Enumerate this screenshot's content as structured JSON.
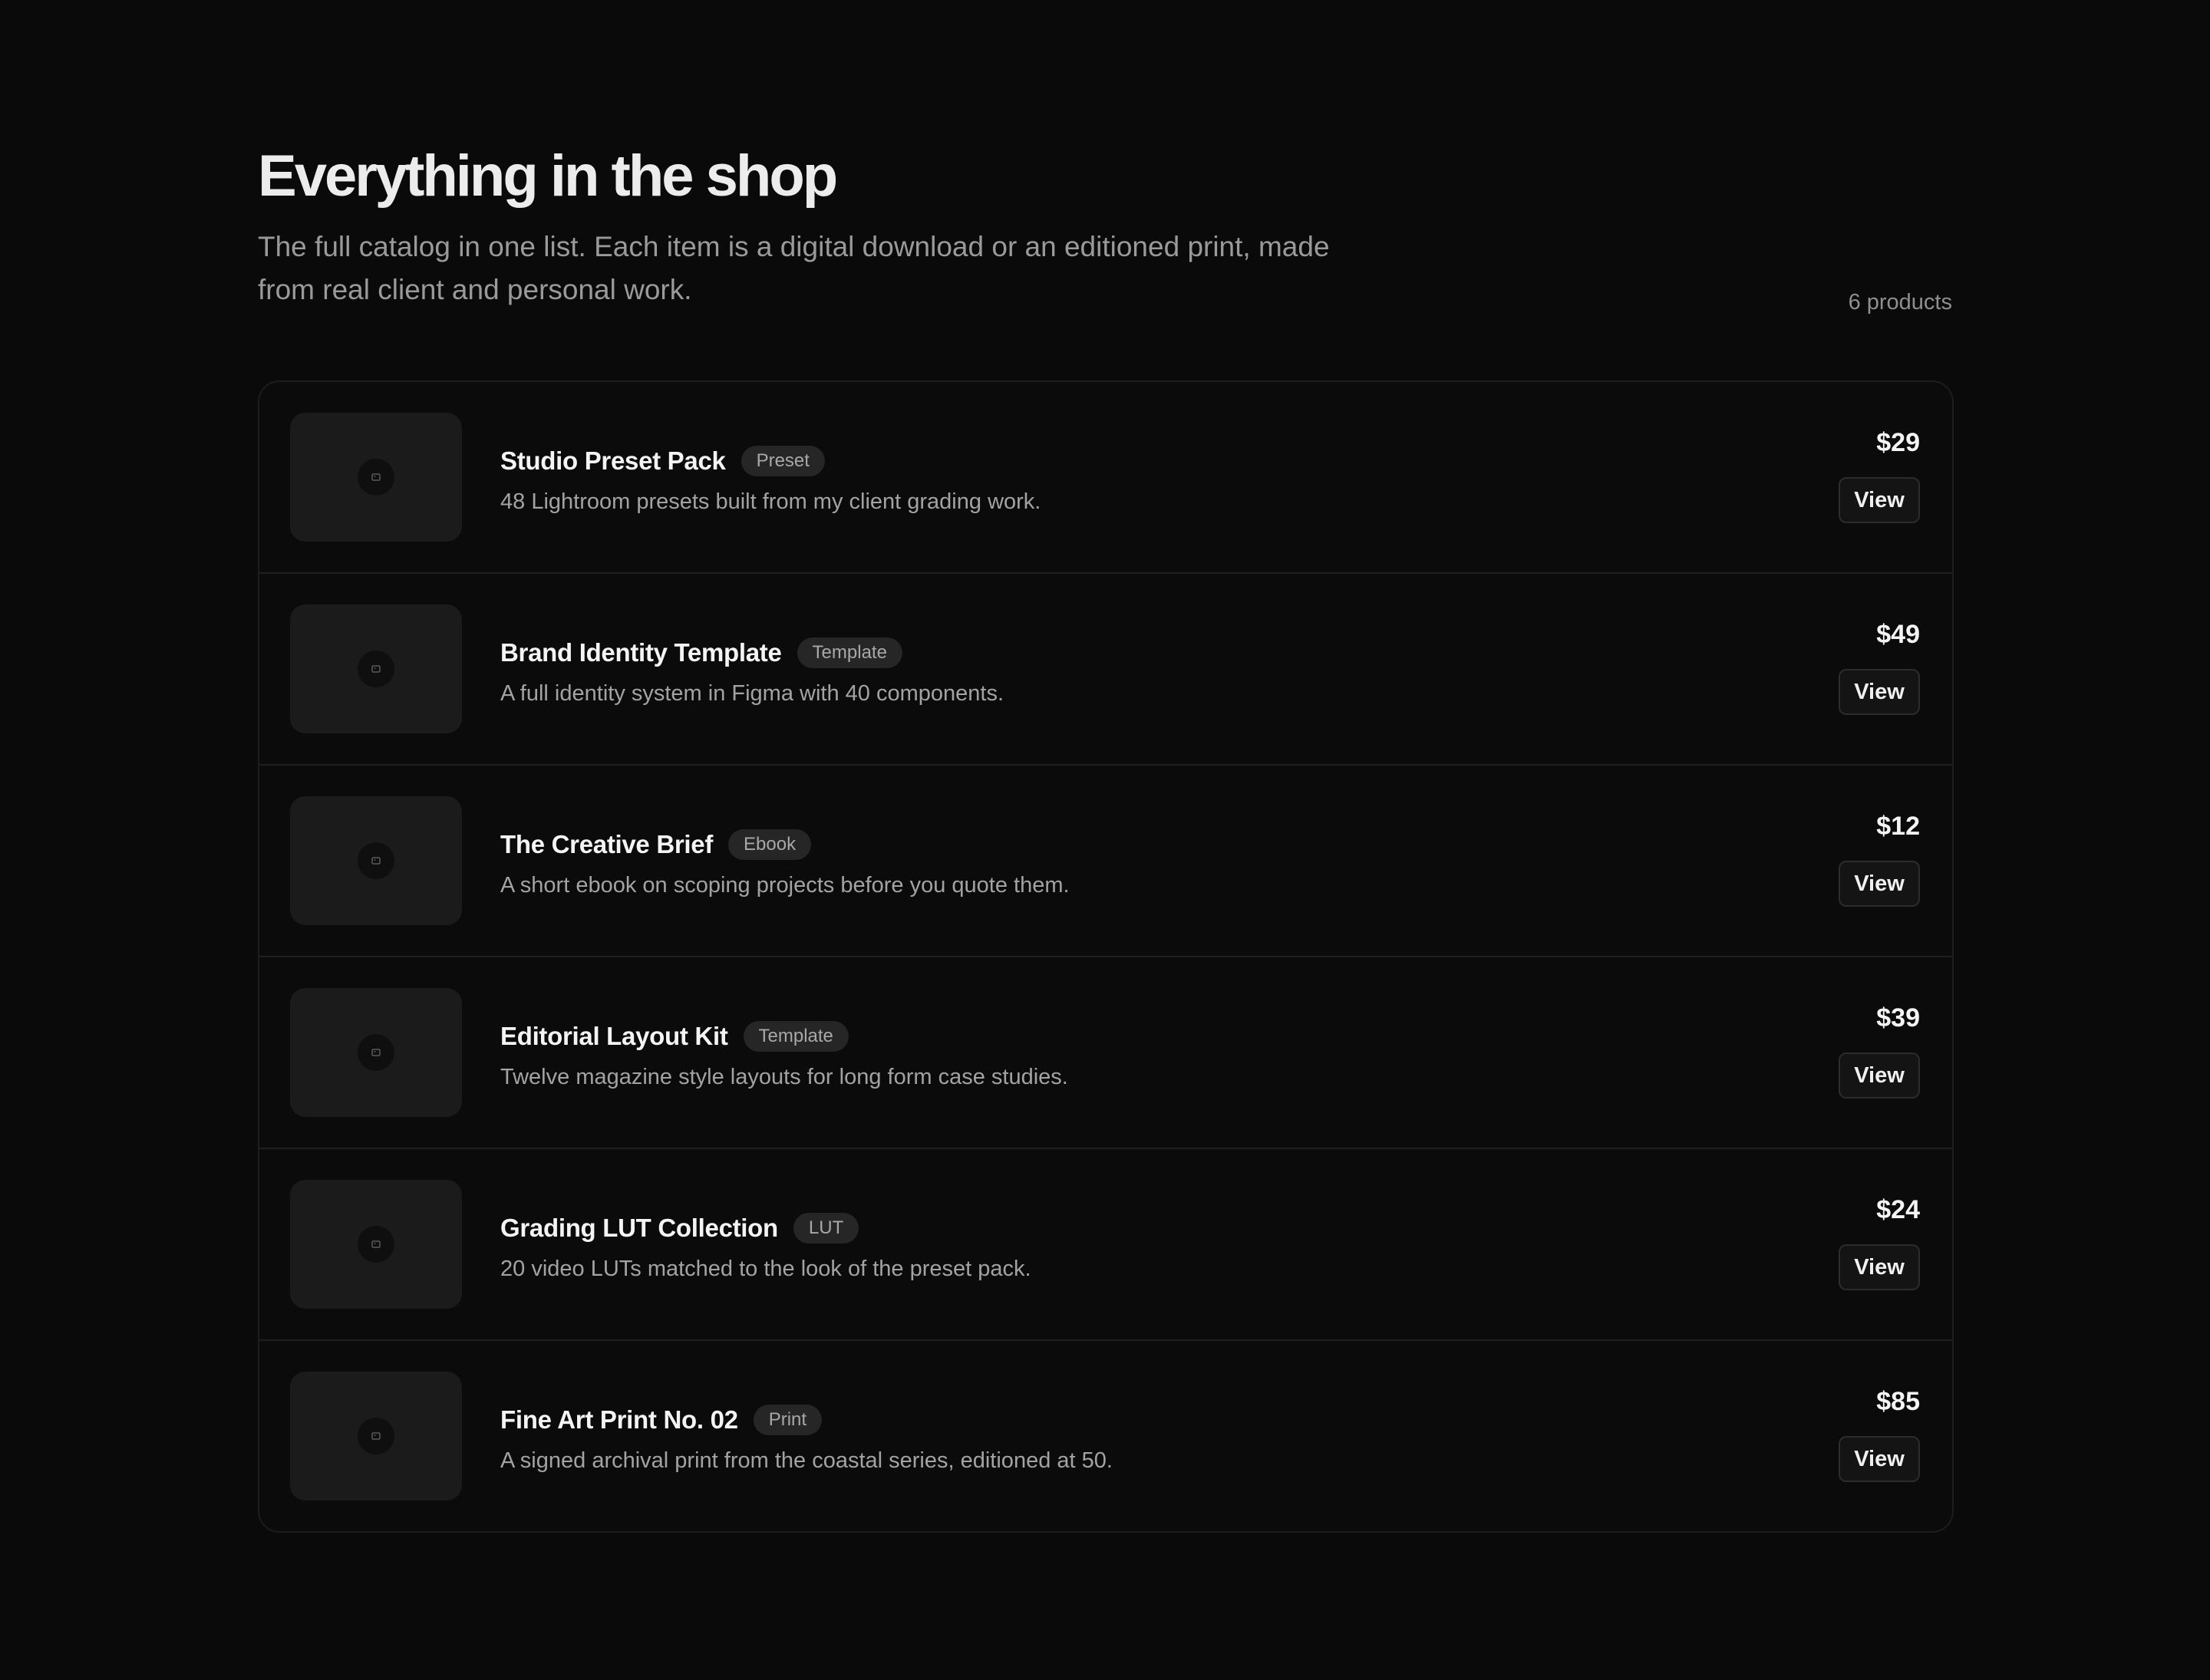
{
  "header": {
    "title": "Everything in the shop",
    "subtitle": "The full catalog in one list. Each item is a digital download or an editioned print, made from real client and personal work.",
    "count": "6 products"
  },
  "products": [
    {
      "name": "Studio Preset Pack",
      "tag": "Preset",
      "description": "48 Lightroom presets built from my client grading work.",
      "price": "$29",
      "action": "View",
      "icon": "image-icon"
    },
    {
      "name": "Brand Identity Template",
      "tag": "Template",
      "description": "A full identity system in Figma with 40 components.",
      "price": "$49",
      "action": "View",
      "icon": "image-icon"
    },
    {
      "name": "The Creative Brief",
      "tag": "Ebook",
      "description": "A short ebook on scoping projects before you quote them.",
      "price": "$12",
      "action": "View",
      "icon": "image-icon"
    },
    {
      "name": "Editorial Layout Kit",
      "tag": "Template",
      "description": "Twelve magazine style layouts for long form case studies.",
      "price": "$39",
      "action": "View",
      "icon": "image-icon"
    },
    {
      "name": "Grading LUT Collection",
      "tag": "LUT",
      "description": "20 video LUTs matched to the look of the preset pack.",
      "price": "$24",
      "action": "View",
      "icon": "image-icon"
    },
    {
      "name": "Fine Art Print No. 02",
      "tag": "Print",
      "description": "A signed archival print from the coastal series, editioned at 50.",
      "price": "$85",
      "action": "View",
      "icon": "image-icon"
    }
  ],
  "colors": {
    "background": "#0a0a0a",
    "card": "#0b0b0b",
    "thumbnail": "#1b1b1b",
    "tag": "#262626",
    "text": "#f4f4f4",
    "muted": "#a3a3a3"
  }
}
